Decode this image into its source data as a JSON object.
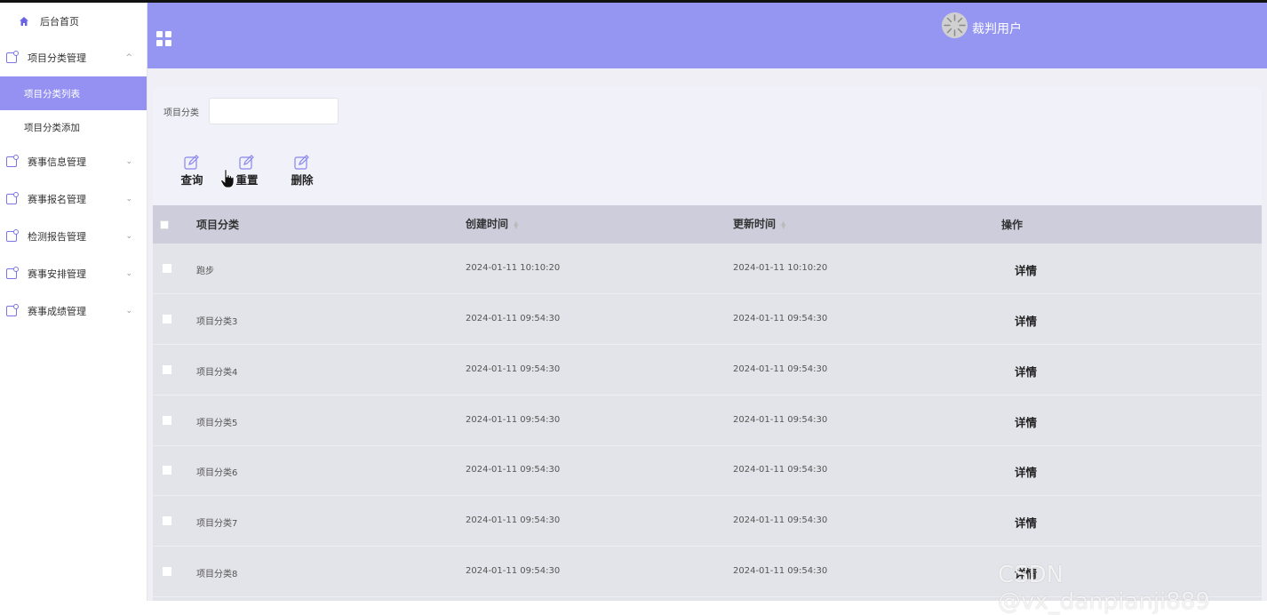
{
  "sidebar": {
    "home": "后台首页",
    "items": [
      {
        "label": "项目分类管理",
        "expanded": true,
        "chevron": "^"
      },
      {
        "label": "赛事信息管理",
        "expanded": false,
        "chevron": "⌄"
      },
      {
        "label": "赛事报名管理",
        "expanded": false,
        "chevron": "⌄"
      },
      {
        "label": "检测报告管理",
        "expanded": false,
        "chevron": "⌄"
      },
      {
        "label": "赛事安排管理",
        "expanded": false,
        "chevron": "⌄"
      },
      {
        "label": "赛事成绩管理",
        "expanded": false,
        "chevron": "⌄"
      }
    ],
    "sub_items": [
      {
        "label": "项目分类列表",
        "active": true
      },
      {
        "label": "项目分类添加",
        "active": false
      }
    ]
  },
  "header": {
    "username": "裁判用户"
  },
  "search": {
    "label": "项目分类",
    "value": ""
  },
  "actions": {
    "query": "查询",
    "reset": "重置",
    "delete": "删除"
  },
  "table": {
    "columns": [
      "项目分类",
      "创建时间",
      "更新时间",
      "操作"
    ],
    "rows": [
      {
        "category": "跑步",
        "created": "2024-01-11 10:10:20",
        "updated": "2024-01-11 10:10:20",
        "action": "详情"
      },
      {
        "category": "项目分类3",
        "created": "2024-01-11 09:54:30",
        "updated": "2024-01-11 09:54:30",
        "action": "详情"
      },
      {
        "category": "项目分类4",
        "created": "2024-01-11 09:54:30",
        "updated": "2024-01-11 09:54:30",
        "action": "详情"
      },
      {
        "category": "项目分类5",
        "created": "2024-01-11 09:54:30",
        "updated": "2024-01-11 09:54:30",
        "action": "详情"
      },
      {
        "category": "项目分类6",
        "created": "2024-01-11 09:54:30",
        "updated": "2024-01-11 09:54:30",
        "action": "详情"
      },
      {
        "category": "项目分类7",
        "created": "2024-01-11 09:54:30",
        "updated": "2024-01-11 09:54:30",
        "action": "详情"
      },
      {
        "category": "项目分类8",
        "created": "2024-01-11 09:54:30",
        "updated": "2024-01-11 09:54:30",
        "action": "详情"
      }
    ]
  },
  "watermark": "CSDN @vx_danpianji889",
  "colors": {
    "accent": "#9496f2",
    "active_menu": "#9491f2",
    "table_header": "#cdcddc",
    "table_body": "#e3e3ea"
  }
}
